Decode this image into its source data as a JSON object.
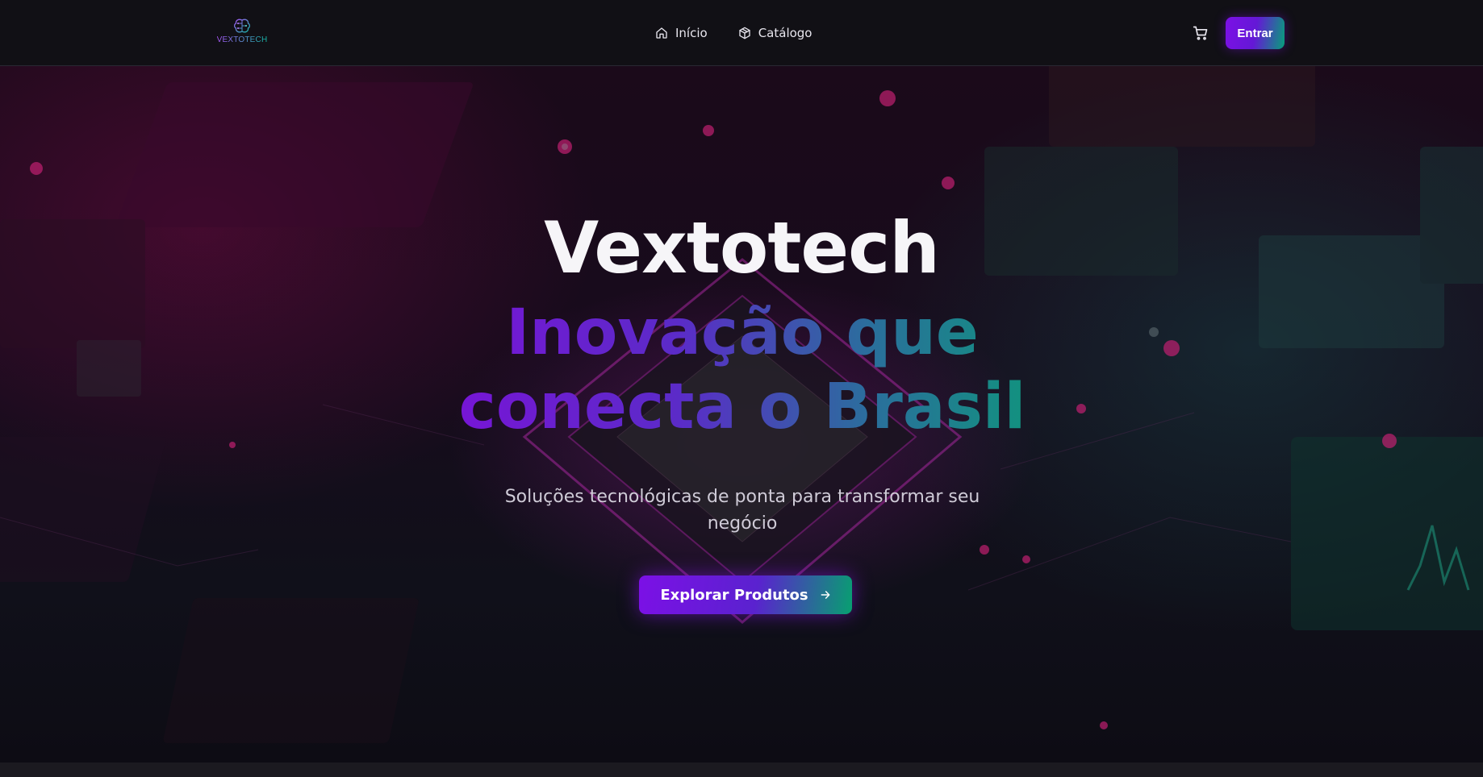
{
  "brand": {
    "logo_text": "VEXTOTECH",
    "logo_icon": "circuit-brain-icon",
    "colors": {
      "primary": "#7c10e6",
      "secondary": "#06a07a",
      "background": "#0c0b10"
    }
  },
  "nav": {
    "items": [
      {
        "label": "Início",
        "icon": "home-icon"
      },
      {
        "label": "Catálogo",
        "icon": "box-icon"
      }
    ],
    "cart_icon": "cart-icon",
    "login_label": "Entrar"
  },
  "hero": {
    "title": "Vextotech",
    "tagline_line1": "Inovação que",
    "tagline_line2": "conecta o Brasil",
    "subtitle_line1": "Soluções tecnológicas de ponta para transformar seu",
    "subtitle_line2": "negócio",
    "cta_label": "Explorar Produtos",
    "cta_icon": "arrow-right-icon"
  }
}
